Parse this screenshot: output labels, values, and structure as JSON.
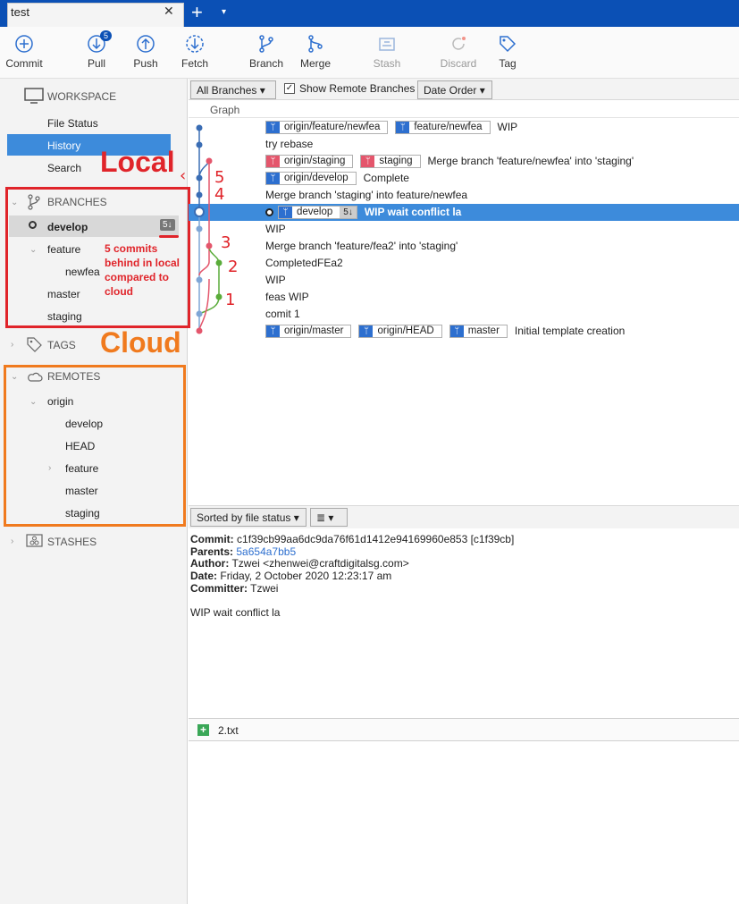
{
  "window": {
    "tab_title": "test",
    "close": "✕",
    "add": "+",
    "menu": "▾"
  },
  "toolbar": {
    "commit": "Commit",
    "pull": "Pull",
    "pull_badge": "5",
    "push": "Push",
    "fetch": "Fetch",
    "branch": "Branch",
    "merge": "Merge",
    "stash": "Stash",
    "discard": "Discard",
    "tag": "Tag"
  },
  "sidebar": {
    "workspace": "WORKSPACE",
    "file_status": "File Status",
    "history": "History",
    "search": "Search",
    "branches": "BRANCHES",
    "develop": "develop",
    "develop_badge": "5↓",
    "feature": "feature",
    "newfea": "newfea",
    "master": "master",
    "staging": "staging",
    "tags": "TAGS",
    "remotes": "REMOTES",
    "origin": "origin",
    "r_develop": "develop",
    "r_head": "HEAD",
    "r_feature": "feature",
    "r_master": "master",
    "r_staging": "staging",
    "stashes": "STASHES"
  },
  "annotations": {
    "local": "Local",
    "cloud": "Cloud",
    "behind_note": [
      "5 commits",
      "behind in local",
      "compared to",
      "cloud"
    ],
    "numbers": [
      "5",
      "4",
      "3",
      "2",
      "1"
    ]
  },
  "main": {
    "branches_filter": "All Branches",
    "show_remote": "Show Remote Branches",
    "order": "Date Order",
    "graph_header": "Graph",
    "commits": [
      {
        "refs": [
          "origin/feature/newfea",
          "feature/newfea"
        ],
        "msg": "WIP"
      },
      {
        "refs": [],
        "msg": "try rebase"
      },
      {
        "refs": [
          "origin/staging",
          "staging"
        ],
        "msg": "Merge branch 'feature/newfea' into 'staging'"
      },
      {
        "refs": [
          "origin/develop"
        ],
        "msg": "Complete"
      },
      {
        "refs": [],
        "msg": "Merge branch 'staging' into feature/newfea"
      },
      {
        "refs": [
          "develop"
        ],
        "ref_badge": "5↓",
        "msg": "WIP wait conflict la"
      },
      {
        "refs": [],
        "msg": "WIP"
      },
      {
        "refs": [],
        "msg": "Merge branch 'feature/fea2' into 'staging'"
      },
      {
        "refs": [],
        "msg": "CompletedFEa2"
      },
      {
        "refs": [],
        "msg": "WIP"
      },
      {
        "refs": [],
        "msg": "feas WIP"
      },
      {
        "refs": [],
        "msg": "comit 1"
      },
      {
        "refs": [
          "origin/master",
          "origin/HEAD",
          "master"
        ],
        "msg": "Initial template creation"
      }
    ]
  },
  "details": {
    "sort": "Sorted by file status",
    "view": "≣",
    "commit_label": "Commit:",
    "commit": "c1f39cb99aa6dc9da76f61d1412e94169960e853 [c1f39cb]",
    "parents_label": "Parents:",
    "parents": "5a654a7bb5",
    "author_label": "Author:",
    "author": "Tzwei <zhenwei@craftdigitalsg.com>",
    "date_label": "Date:",
    "date": "Friday, 2 October 2020 12:23:17 am",
    "committer_label": "Committer:",
    "committer": "Tzwei",
    "message": "WIP wait conflict la",
    "file": "2.txt"
  },
  "colors": {
    "brand": "#0b50b5",
    "selection": "#3d8bdb",
    "red": "#e0242a",
    "orange": "#f07a1e",
    "graph_blue": "#3a6db4",
    "graph_pink": "#e4566c",
    "graph_green": "#5aac3a"
  }
}
